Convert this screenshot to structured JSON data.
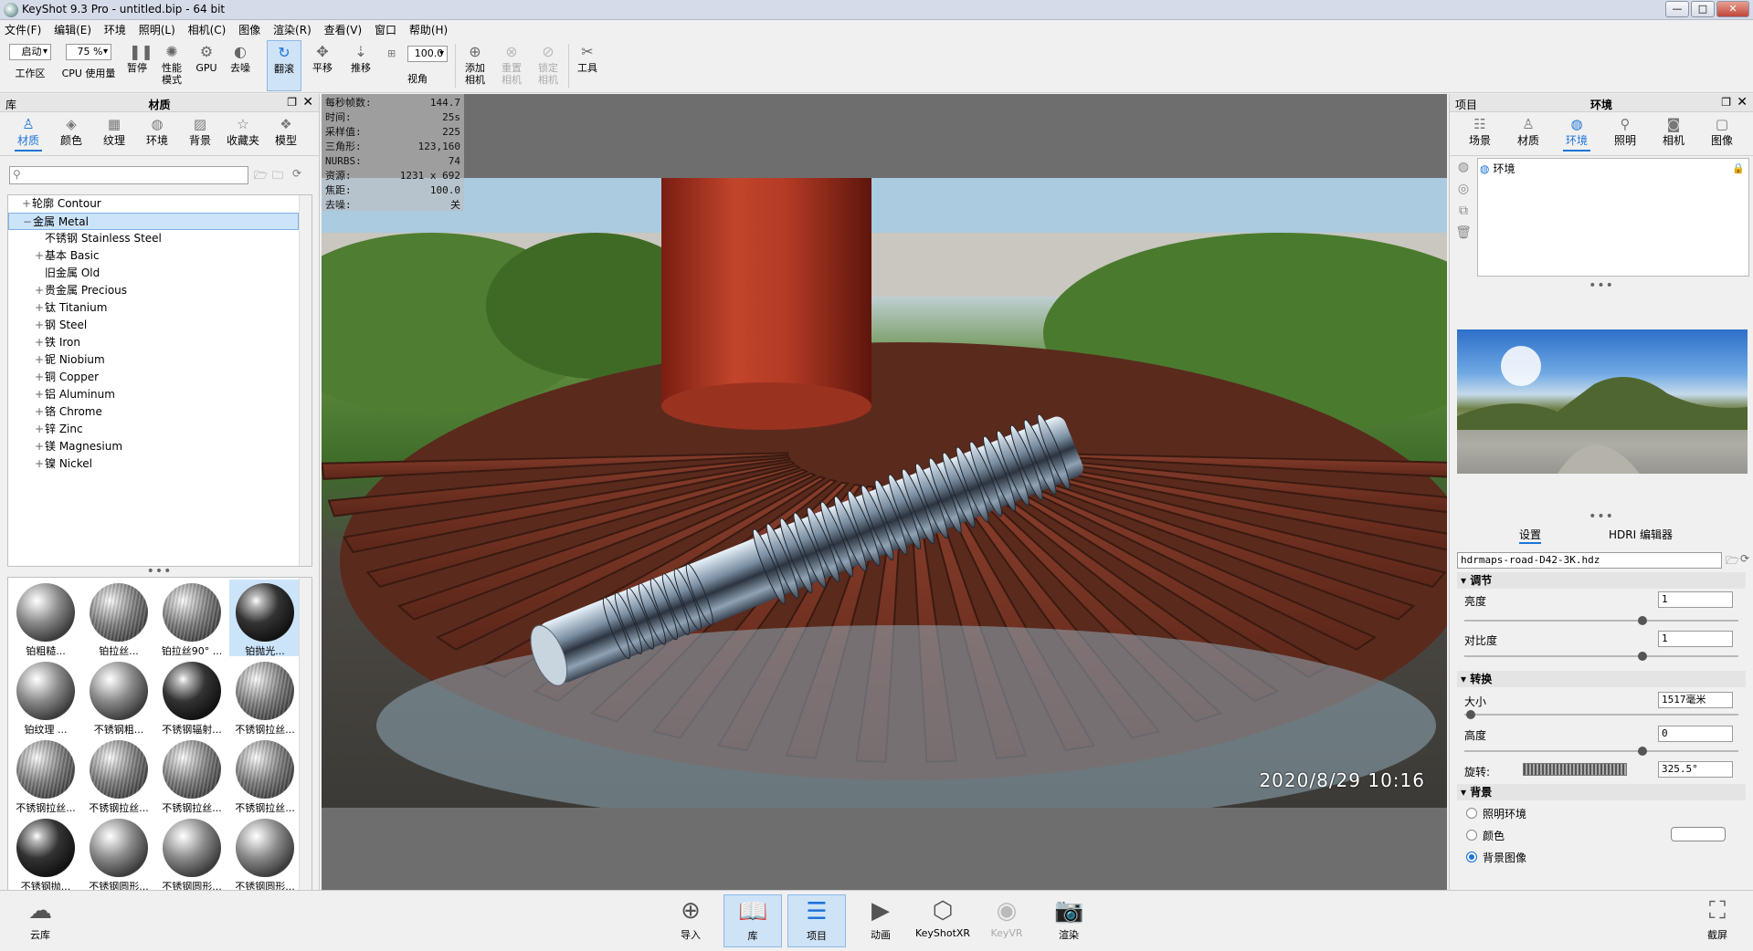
{
  "window": {
    "title": "KeyShot 9.3 Pro  - untitled.bip  - 64 bit",
    "min": "—",
    "max": "□",
    "close": "✕"
  },
  "menu": [
    "文件(F)",
    "编辑(E)",
    "环境",
    "照明(L)",
    "相机(C)",
    "图像",
    "渲染(R)",
    "查看(V)",
    "窗口",
    "帮助(H)"
  ],
  "toolbar": {
    "workspace_value": "启动",
    "workspace_label": "工作区",
    "cpu_value": "75 %",
    "cpu_label": "CPU 使用量",
    "pause": "暂停",
    "perf_line1": "性能",
    "perf_line2": "模式",
    "gpu": "GPU",
    "denoise": "去噪",
    "tumble": "翻滚",
    "pan": "平移",
    "dolly": "推移",
    "fov_value": "100.0",
    "fov_label": "视角",
    "add_cam_1": "添加",
    "add_cam_2": "相机",
    "reset_cam_1": "重置",
    "reset_cam_2": "相机",
    "lock_cam_1": "锁定",
    "lock_cam_2": "相机",
    "tools": "工具"
  },
  "library": {
    "panel_left": "库",
    "panel_title": "材质",
    "tabs": [
      "材质",
      "颜色",
      "纹理",
      "环境",
      "背景",
      "收藏夹",
      "模型"
    ],
    "tree": [
      {
        "label": "轮廓 Contour",
        "pm": "+",
        "level": 1
      },
      {
        "label": "金属 Metal",
        "pm": "−",
        "level": 1
      },
      {
        "label": "不锈钢 Stainless Steel",
        "pm": "",
        "level": 2
      },
      {
        "label": "基本 Basic",
        "pm": "+",
        "level": 2
      },
      {
        "label": "旧金属 Old",
        "pm": "",
        "level": 2
      },
      {
        "label": "贵金属 Precious",
        "pm": "+",
        "level": 2
      },
      {
        "label": "钛 Titanium",
        "pm": "+",
        "level": 2
      },
      {
        "label": "钢 Steel",
        "pm": "+",
        "level": 2
      },
      {
        "label": "铁 Iron",
        "pm": "+",
        "level": 2
      },
      {
        "label": "铌 Niobium",
        "pm": "+",
        "level": 2
      },
      {
        "label": "铜 Copper",
        "pm": "+",
        "level": 2
      },
      {
        "label": "铝 Aluminum",
        "pm": "+",
        "level": 2
      },
      {
        "label": "铬 Chrome",
        "pm": "+",
        "level": 2
      },
      {
        "label": "锌 Zinc",
        "pm": "+",
        "level": 2
      },
      {
        "label": "镁 Magnesium",
        "pm": "+",
        "level": 2
      },
      {
        "label": "镍 Nickel",
        "pm": "+",
        "level": 2
      }
    ],
    "materials": [
      "铂粗糙...",
      "铂拉丝...",
      "铂拉丝90° ...",
      "铂抛光...",
      "铂纹理 ...",
      "不锈钢粗...",
      "不锈钢辐射...",
      "不锈钢拉丝...",
      "不锈钢拉丝...",
      "不锈钢拉丝...",
      "不锈钢拉丝...",
      "不锈钢拉丝...",
      "不锈钢抛...",
      "不锈钢圆形...",
      "不锈钢圆形...",
      "不锈钢圆形...",
      "",
      "",
      "",
      ""
    ]
  },
  "stats": [
    {
      "k": "每秒帧数:",
      "v": "144.7"
    },
    {
      "k": "时间:",
      "v": "25s"
    },
    {
      "k": "采样值:",
      "v": "225"
    },
    {
      "k": "三角形:",
      "v": "123,160"
    },
    {
      "k": "NURBS:",
      "v": "74"
    },
    {
      "k": "资源:",
      "v": "1231 x 692"
    },
    {
      "k": "焦距:",
      "v": "100.0"
    },
    {
      "k": "去噪:",
      "v": "关"
    }
  ],
  "stamp": "2020/8/29  10:16",
  "project": {
    "panel_left": "项目",
    "panel_title": "环境",
    "tabs": [
      "场景",
      "材质",
      "环境",
      "照明",
      "相机",
      "图像"
    ],
    "env_item": "环境",
    "subtab_settings": "设置",
    "subtab_hdri": "HDRI 编辑器",
    "hdri_file": "hdrmaps-road-D42-3K.hdz",
    "adjust": "调节",
    "brightness": "亮度",
    "brightness_val": "1",
    "contrast": "对比度",
    "contrast_val": "1",
    "transform": "转换",
    "size": "大小",
    "size_val": "1517毫米",
    "height": "高度",
    "height_val": "0",
    "rotation": "旋转:",
    "rotation_val": "325.5°",
    "background": "背景",
    "bg_light": "照明环境",
    "bg_color": "颜色",
    "bg_image": "背景图像"
  },
  "bottom": {
    "cloud": "云库",
    "import": "导入",
    "library": "库",
    "project": "项目",
    "animation": "动画",
    "keyshotxr": "KeyShotXR",
    "keyvr": "KeyVR",
    "render": "渲染",
    "screenshot": "截屏"
  },
  "colors": {
    "accent": "#1d74d8",
    "selection": "#cce4fa"
  }
}
